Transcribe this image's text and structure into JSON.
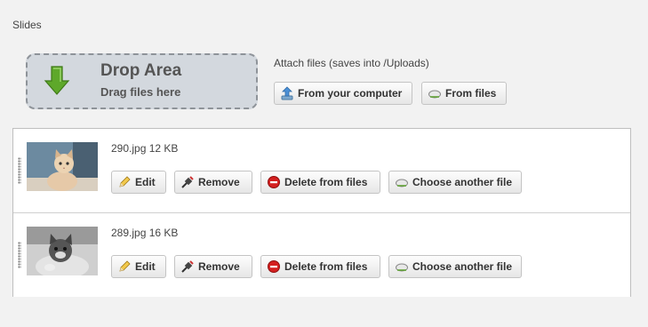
{
  "section": {
    "label": "Slides"
  },
  "drop_area": {
    "title": "Drop Area",
    "subtitle": "Drag files here",
    "icon": "green-down-arrow-icon"
  },
  "attach": {
    "label": "Attach files (saves into /Uploads)",
    "from_computer": "From your computer",
    "from_files": "From files"
  },
  "slides": [
    {
      "filename": "290.jpg 12 KB",
      "thumbnail": "kitten-photo",
      "actions": {
        "edit": "Edit",
        "remove": "Remove",
        "delete": "Delete from files",
        "choose": "Choose another file"
      }
    },
    {
      "filename": "289.jpg 16 KB",
      "thumbnail": "kitten-photo-grayscale",
      "actions": {
        "edit": "Edit",
        "remove": "Remove",
        "delete": "Delete from files",
        "choose": "Choose another file"
      }
    }
  ],
  "colors": {
    "page_bg": "#f2f2f2",
    "drop_bg": "#d3d8de",
    "arrow_green": "#5ea82a",
    "delete_red": "#d42020"
  }
}
